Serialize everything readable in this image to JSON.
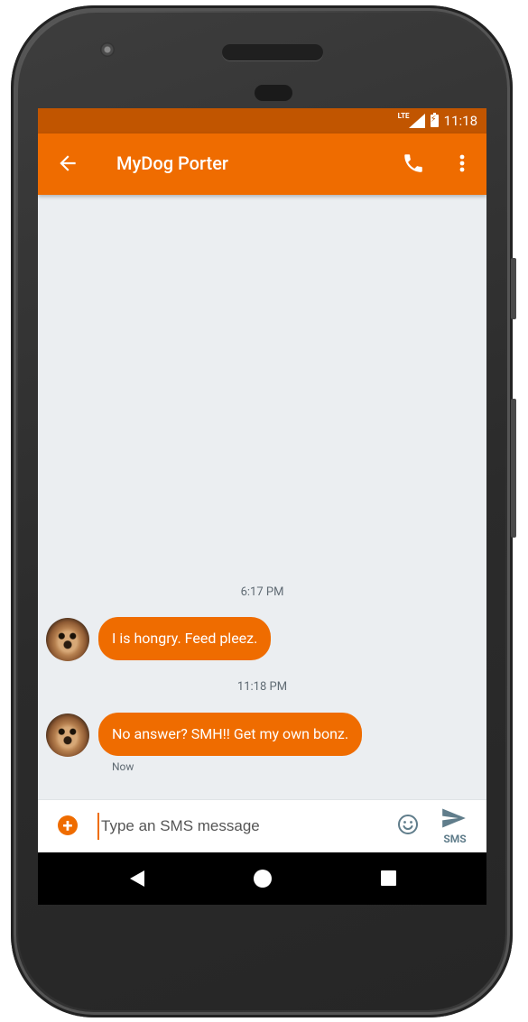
{
  "status_bar": {
    "time": "11:18",
    "network": "LTE"
  },
  "app_bar": {
    "title": "MyDog Porter"
  },
  "conversation": {
    "messages": [
      {
        "timestamp": "6:17 PM",
        "text": "I is hongry. Feed pleez.",
        "meta": ""
      },
      {
        "timestamp": "11:18 PM",
        "text": "No answer? SMH!! Get my own bonz.",
        "meta": "Now"
      }
    ]
  },
  "compose": {
    "placeholder": "Type an SMS message",
    "send_label": "SMS"
  },
  "colors": {
    "accent": "#ef6c00",
    "status_bar": "#c15500",
    "background": "#ebeef1"
  },
  "icons": {
    "back": "arrow-back-icon",
    "call": "phone-icon",
    "overflow": "more-vert-icon",
    "attach": "add-circle-icon",
    "emoji": "emoji-icon",
    "send": "send-icon"
  }
}
